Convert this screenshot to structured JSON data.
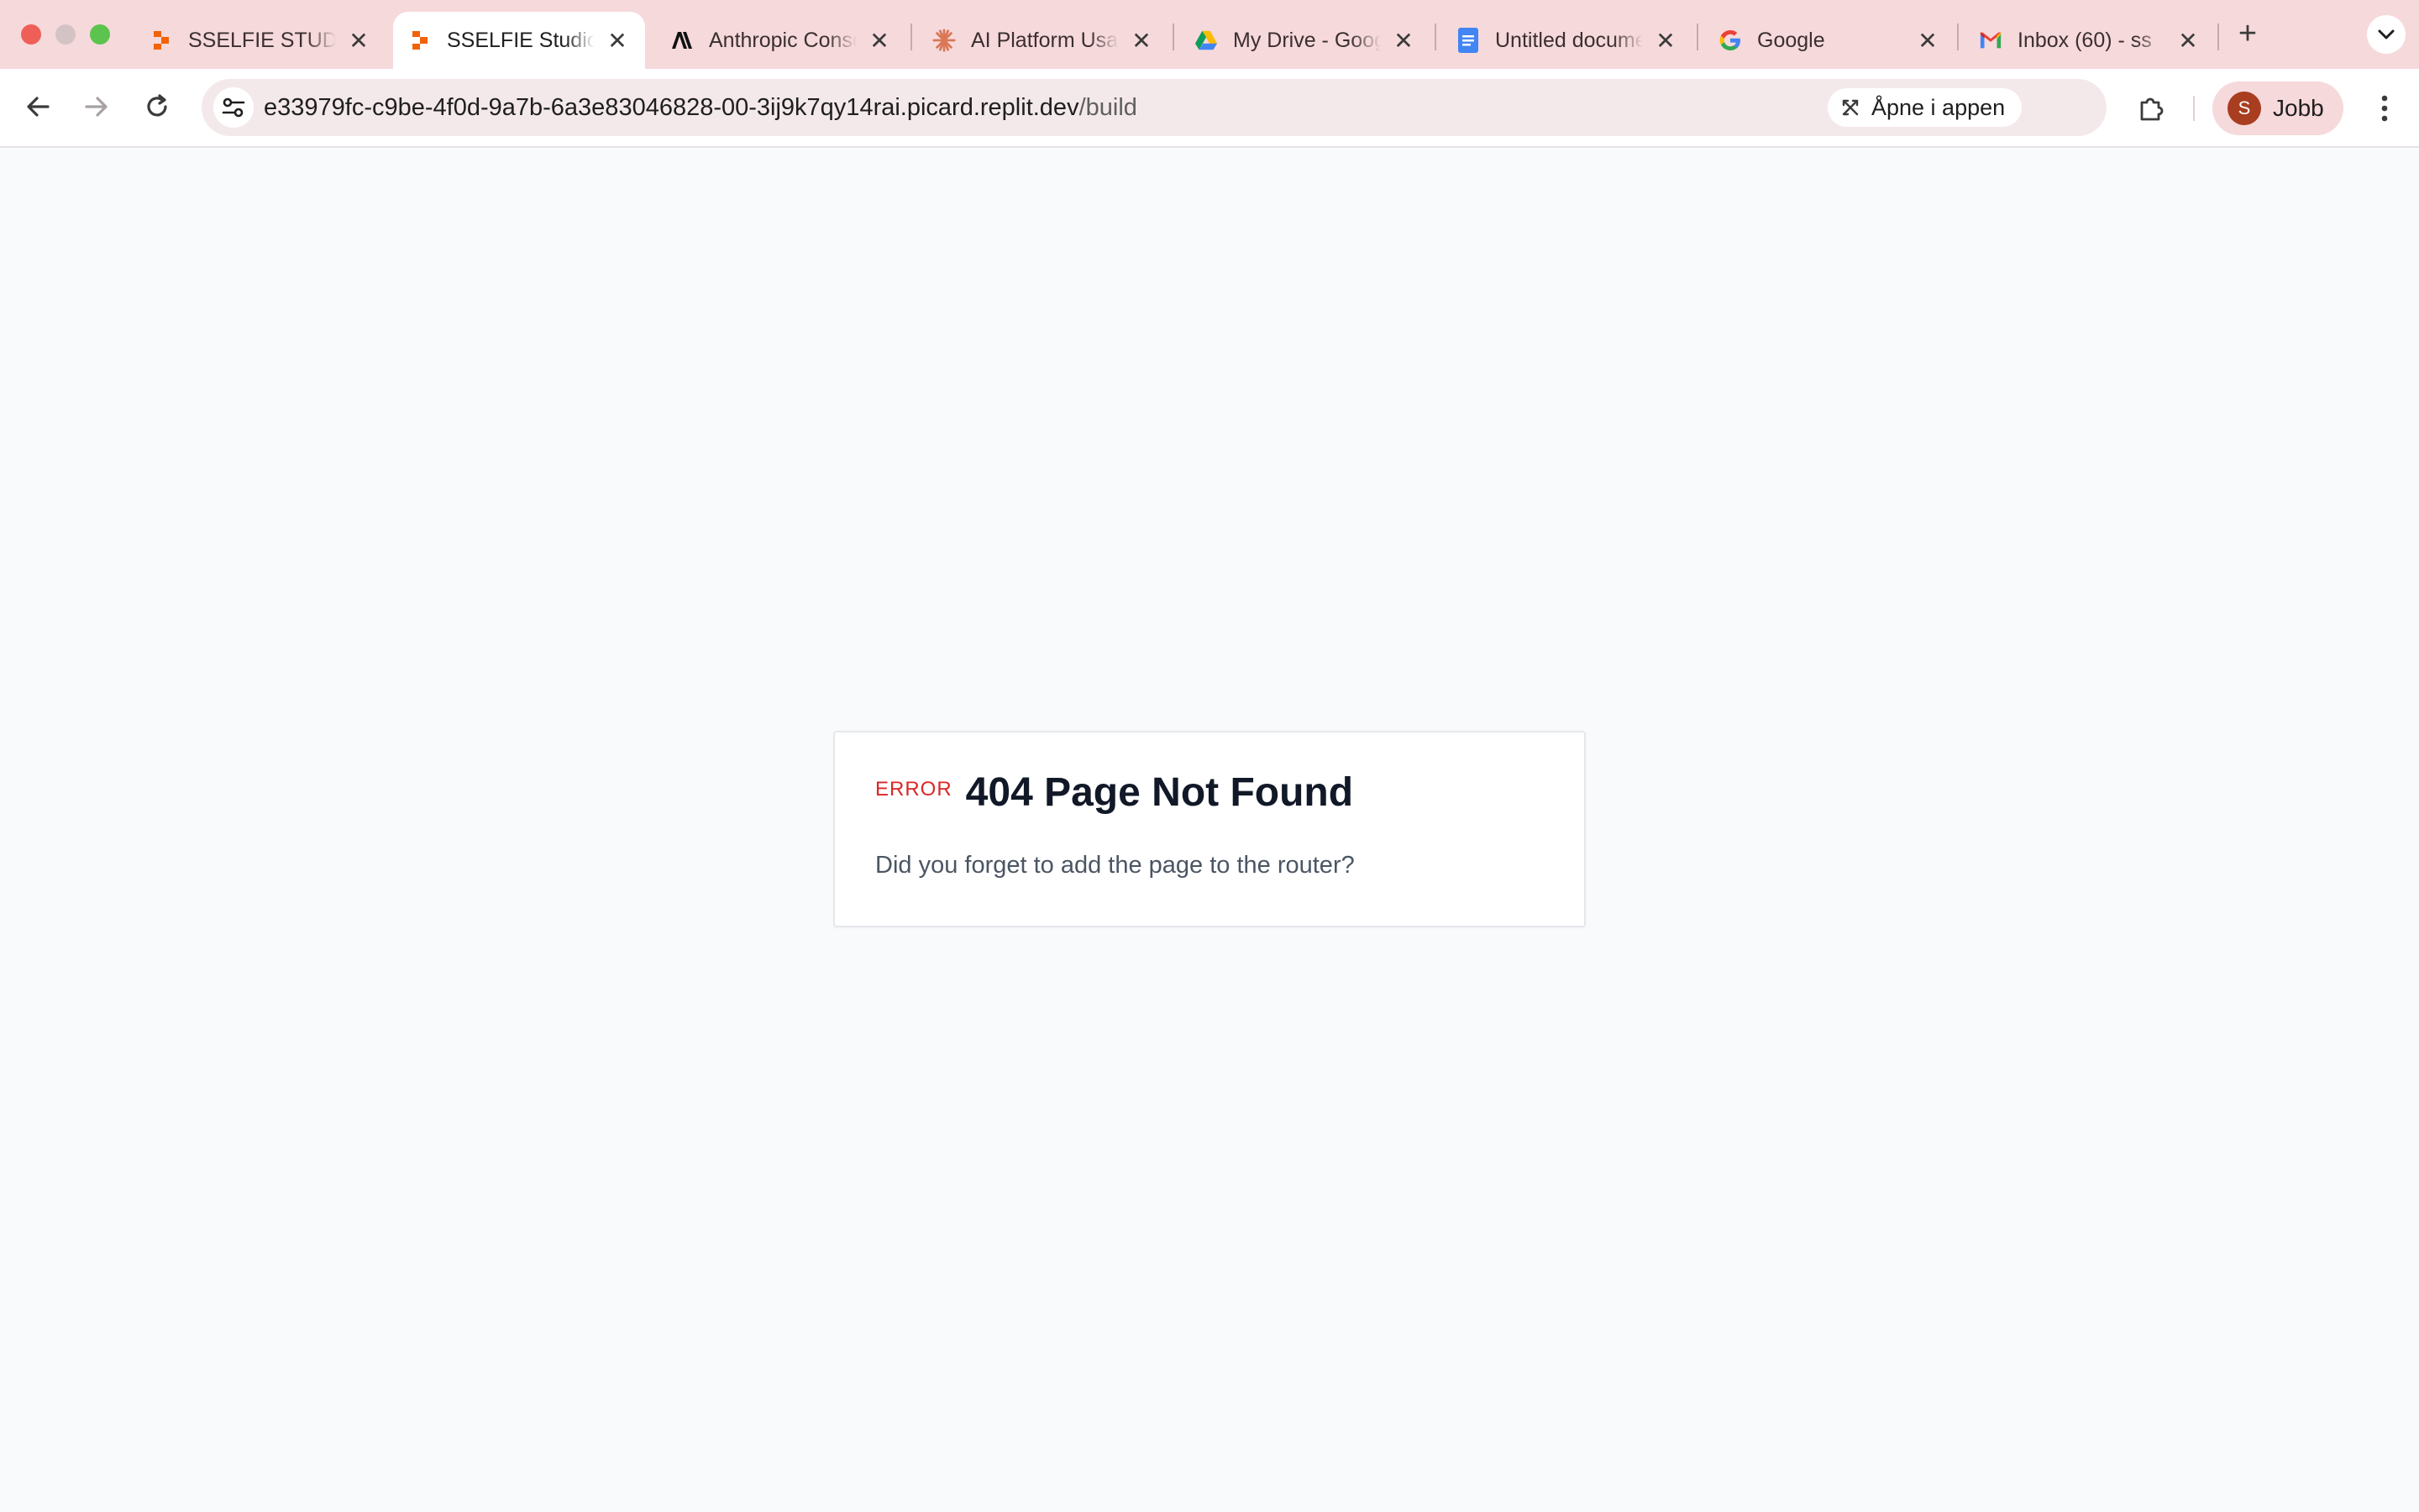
{
  "browser": {
    "tabs": [
      {
        "title": "SSELFIE STUDIO",
        "icon": "replit-icon",
        "active": false
      },
      {
        "title": "SSELFIE Studio",
        "icon": "replit-icon",
        "active": true
      },
      {
        "title": "Anthropic Console",
        "icon": "anthropic-icon",
        "active": false
      },
      {
        "title": "AI Platform Usage",
        "icon": "claude-icon",
        "active": false
      },
      {
        "title": "My Drive - Google Drive",
        "icon": "google-drive-icon",
        "active": false
      },
      {
        "title": "Untitled document",
        "icon": "google-docs-icon",
        "active": false
      },
      {
        "title": "Google",
        "icon": "google-icon",
        "active": false
      },
      {
        "title": "Inbox (60) - ss",
        "icon": "gmail-icon",
        "active": false
      }
    ],
    "close_glyph": "✕",
    "new_tab_glyph": "+",
    "url_host": "e33979fc-c9be-4f0d-9a7b-6a3e83046828-00-3ij9k7qy14rai.picard.replit.dev",
    "url_path": "/build",
    "open_in_app_label": "Åpne i appen",
    "profile": {
      "initial": "S",
      "name": "Jobb",
      "avatar_color": "#a93d1f"
    },
    "colors": {
      "tabstrip": "#f6d9db",
      "omnibox": "#f4e9ea"
    }
  },
  "page": {
    "error_label": "ERROR",
    "title": "404 Page Not Found",
    "message": "Did you forget to add the page to the router?",
    "colors": {
      "error_label": "#dc2626",
      "title": "#111827",
      "message": "#4b5563",
      "background": "#f9fafb"
    }
  }
}
